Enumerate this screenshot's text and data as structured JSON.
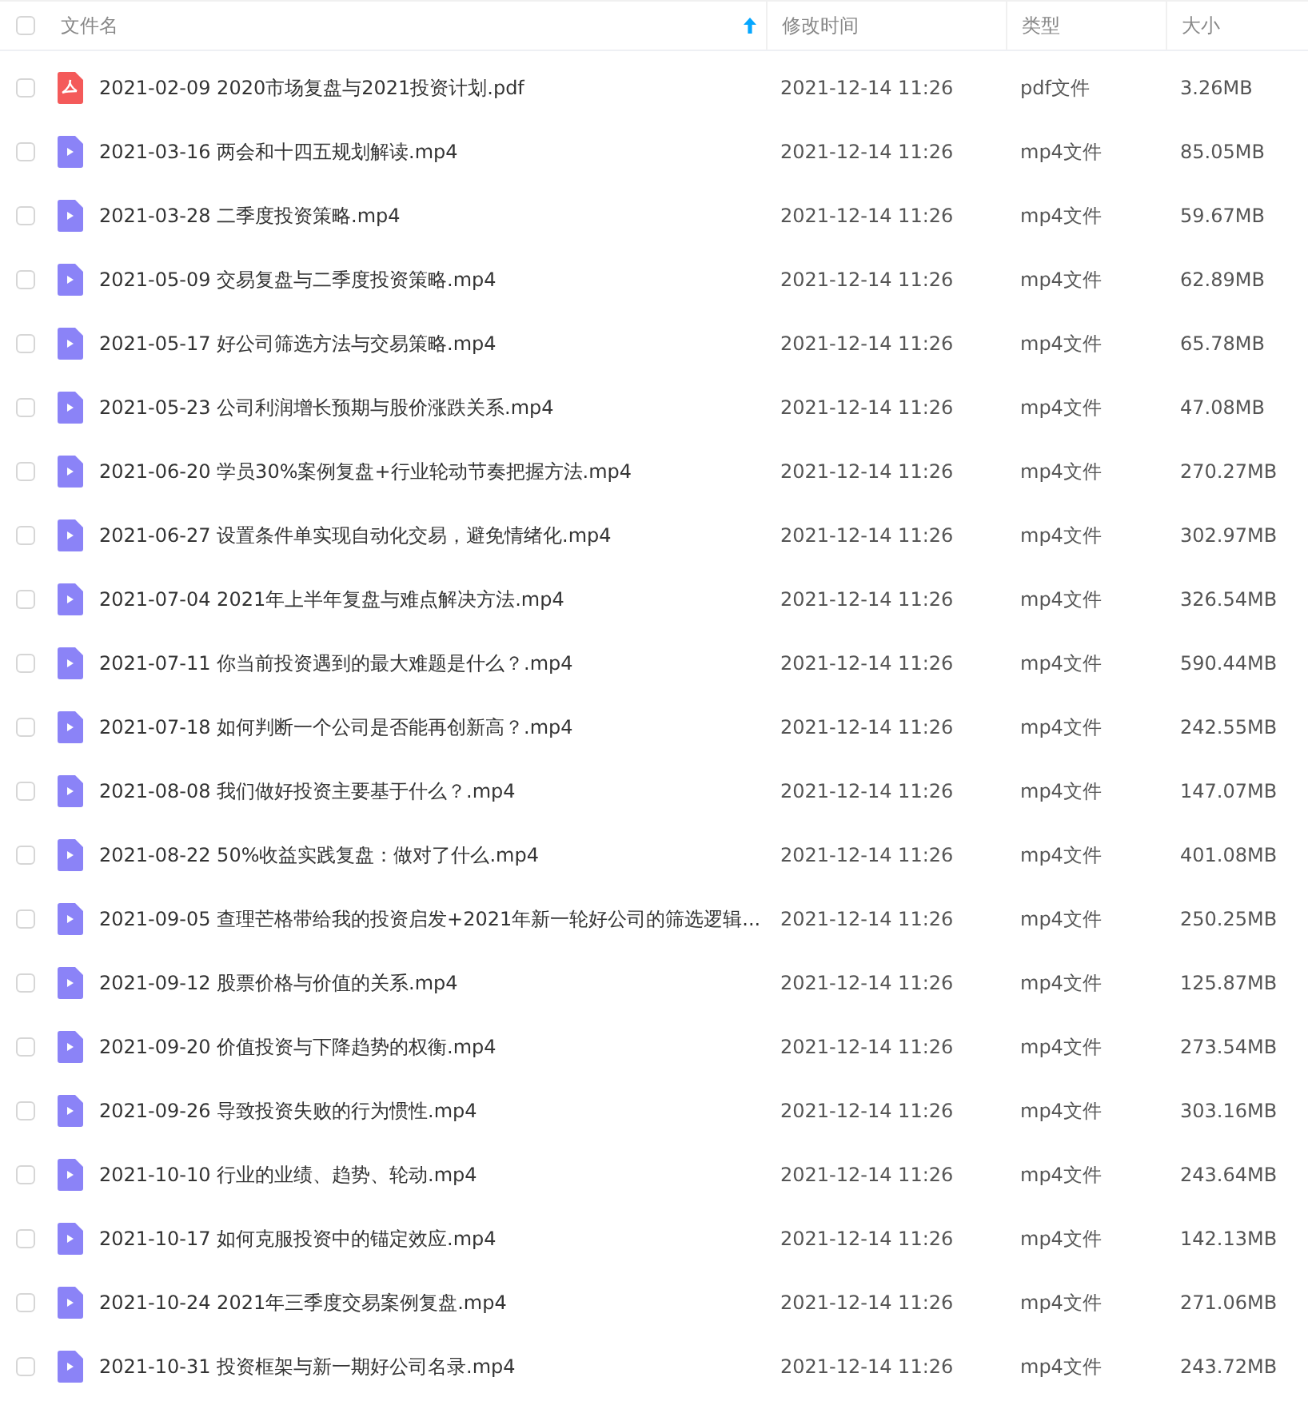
{
  "table": {
    "select_all": {
      "checked": false
    },
    "columns": [
      {
        "label": "文件名",
        "sorted": true
      },
      {
        "label": "修改时间",
        "sorted": false
      },
      {
        "label": "类型",
        "sorted": false
      },
      {
        "label": "大小",
        "sorted": false
      }
    ],
    "rows": [
      {
        "checked": false,
        "kind": "pdf",
        "name": "2021-02-09 2020市场复盘与2021投资计划.pdf",
        "modified": "2021-12-14 11:26",
        "type": "pdf文件",
        "size": "3.26MB"
      },
      {
        "checked": false,
        "kind": "video",
        "name": "2021-03-16 两会和十四五规划解读.mp4",
        "modified": "2021-12-14 11:26",
        "type": "mp4文件",
        "size": "85.05MB"
      },
      {
        "checked": false,
        "kind": "video",
        "name": "2021-03-28 二季度投资策略.mp4",
        "modified": "2021-12-14 11:26",
        "type": "mp4文件",
        "size": "59.67MB"
      },
      {
        "checked": false,
        "kind": "video",
        "name": "2021-05-09 交易复盘与二季度投资策略.mp4",
        "modified": "2021-12-14 11:26",
        "type": "mp4文件",
        "size": "62.89MB"
      },
      {
        "checked": false,
        "kind": "video",
        "name": "2021-05-17 好公司筛选方法与交易策略.mp4",
        "modified": "2021-12-14 11:26",
        "type": "mp4文件",
        "size": "65.78MB"
      },
      {
        "checked": false,
        "kind": "video",
        "name": "2021-05-23 公司利润增长预期与股价涨跌关系.mp4",
        "modified": "2021-12-14 11:26",
        "type": "mp4文件",
        "size": "47.08MB"
      },
      {
        "checked": false,
        "kind": "video",
        "name": "2021-06-20 学员30%案例复盘+行业轮动节奏把握方法.mp4",
        "modified": "2021-12-14 11:26",
        "type": "mp4文件",
        "size": "270.27MB"
      },
      {
        "checked": false,
        "kind": "video",
        "name": "2021-06-27 设置条件单实现自动化交易，避免情绪化.mp4",
        "modified": "2021-12-14 11:26",
        "type": "mp4文件",
        "size": "302.97MB"
      },
      {
        "checked": false,
        "kind": "video",
        "name": "2021-07-04 2021年上半年复盘与难点解决方法.mp4",
        "modified": "2021-12-14 11:26",
        "type": "mp4文件",
        "size": "326.54MB"
      },
      {
        "checked": false,
        "kind": "video",
        "name": "2021-07-11 你当前投资遇到的最大难题是什么？.mp4",
        "modified": "2021-12-14 11:26",
        "type": "mp4文件",
        "size": "590.44MB"
      },
      {
        "checked": false,
        "kind": "video",
        "name": "2021-07-18 如何判断一个公司是否能再创新高？.mp4",
        "modified": "2021-12-14 11:26",
        "type": "mp4文件",
        "size": "242.55MB"
      },
      {
        "checked": false,
        "kind": "video",
        "name": "2021-08-08 我们做好投资主要基于什么？.mp4",
        "modified": "2021-12-14 11:26",
        "type": "mp4文件",
        "size": "147.07MB"
      },
      {
        "checked": false,
        "kind": "video",
        "name": "2021-08-22 50%收益实践复盘：做对了什么.mp4",
        "modified": "2021-12-14 11:26",
        "type": "mp4文件",
        "size": "401.08MB"
      },
      {
        "checked": false,
        "kind": "video",
        "name": "2021-09-05 查理芒格带给我的投资启发+2021年新一轮好公司的筛选逻辑...",
        "modified": "2021-12-14 11:26",
        "type": "mp4文件",
        "size": "250.25MB"
      },
      {
        "checked": false,
        "kind": "video",
        "name": "2021-09-12 股票价格与价值的关系.mp4",
        "modified": "2021-12-14 11:26",
        "type": "mp4文件",
        "size": "125.87MB"
      },
      {
        "checked": false,
        "kind": "video",
        "name": "2021-09-20 价值投资与下降趋势的权衡.mp4",
        "modified": "2021-12-14 11:26",
        "type": "mp4文件",
        "size": "273.54MB"
      },
      {
        "checked": false,
        "kind": "video",
        "name": "2021-09-26 导致投资失败的行为惯性.mp4",
        "modified": "2021-12-14 11:26",
        "type": "mp4文件",
        "size": "303.16MB"
      },
      {
        "checked": false,
        "kind": "video",
        "name": "2021-10-10 行业的业绩、趋势、轮动.mp4",
        "modified": "2021-12-14 11:26",
        "type": "mp4文件",
        "size": "243.64MB"
      },
      {
        "checked": false,
        "kind": "video",
        "name": "2021-10-17 如何克服投资中的锚定效应.mp4",
        "modified": "2021-12-14 11:26",
        "type": "mp4文件",
        "size": "142.13MB"
      },
      {
        "checked": false,
        "kind": "video",
        "name": "2021-10-24 2021年三季度交易案例复盘.mp4",
        "modified": "2021-12-14 11:26",
        "type": "mp4文件",
        "size": "271.06MB"
      },
      {
        "checked": false,
        "kind": "video",
        "name": "2021-10-31 投资框架与新一期好公司名录.mp4",
        "modified": "2021-12-14 11:26",
        "type": "mp4文件",
        "size": "243.72MB"
      }
    ]
  }
}
